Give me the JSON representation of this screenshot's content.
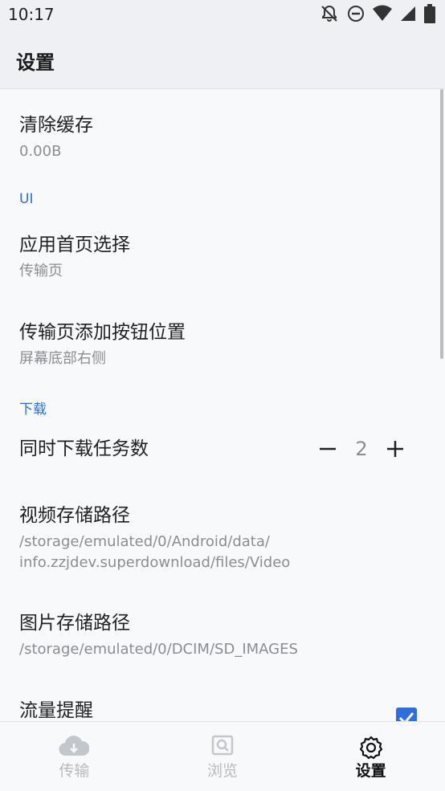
{
  "status_bar": {
    "time": "10:17",
    "icons": [
      "notifications-off-icon",
      "do-not-disturb-icon",
      "wifi-icon",
      "cellular-signal-icon",
      "battery-icon"
    ]
  },
  "app_bar": {
    "title": "设置"
  },
  "settings": {
    "clear_cache": {
      "title": "清除缓存",
      "summary": "0.00B"
    },
    "category_ui": "UI",
    "home_page": {
      "title": "应用首页选择",
      "summary": "传输页"
    },
    "add_button_position": {
      "title": "传输页添加按钮位置",
      "summary": "屏幕底部右侧"
    },
    "category_download": "下载",
    "concurrent_downloads": {
      "title": "同时下载任务数",
      "value": "2"
    },
    "video_path": {
      "title": "视频存储路径",
      "summary_line1": "/storage/emulated/0/Android/data/",
      "summary_line2": "info.zzjdev.superdownload/files/Video"
    },
    "image_path": {
      "title": "图片存储路径",
      "summary": "/storage/emulated/0/DCIM/SD_IMAGES"
    },
    "data_reminder": {
      "title": "流量提醒",
      "checked": true
    }
  },
  "bottom_nav": {
    "items": [
      {
        "label": "传输",
        "icon": "cloud-download-icon",
        "active": false
      },
      {
        "label": "浏览",
        "icon": "browse-icon",
        "active": false
      },
      {
        "label": "设置",
        "icon": "gear-icon",
        "active": true
      }
    ]
  },
  "colors": {
    "accent": "#2b6fe0",
    "summary_text": "#8a8d93",
    "inactive_nav": "#b6b9be"
  }
}
